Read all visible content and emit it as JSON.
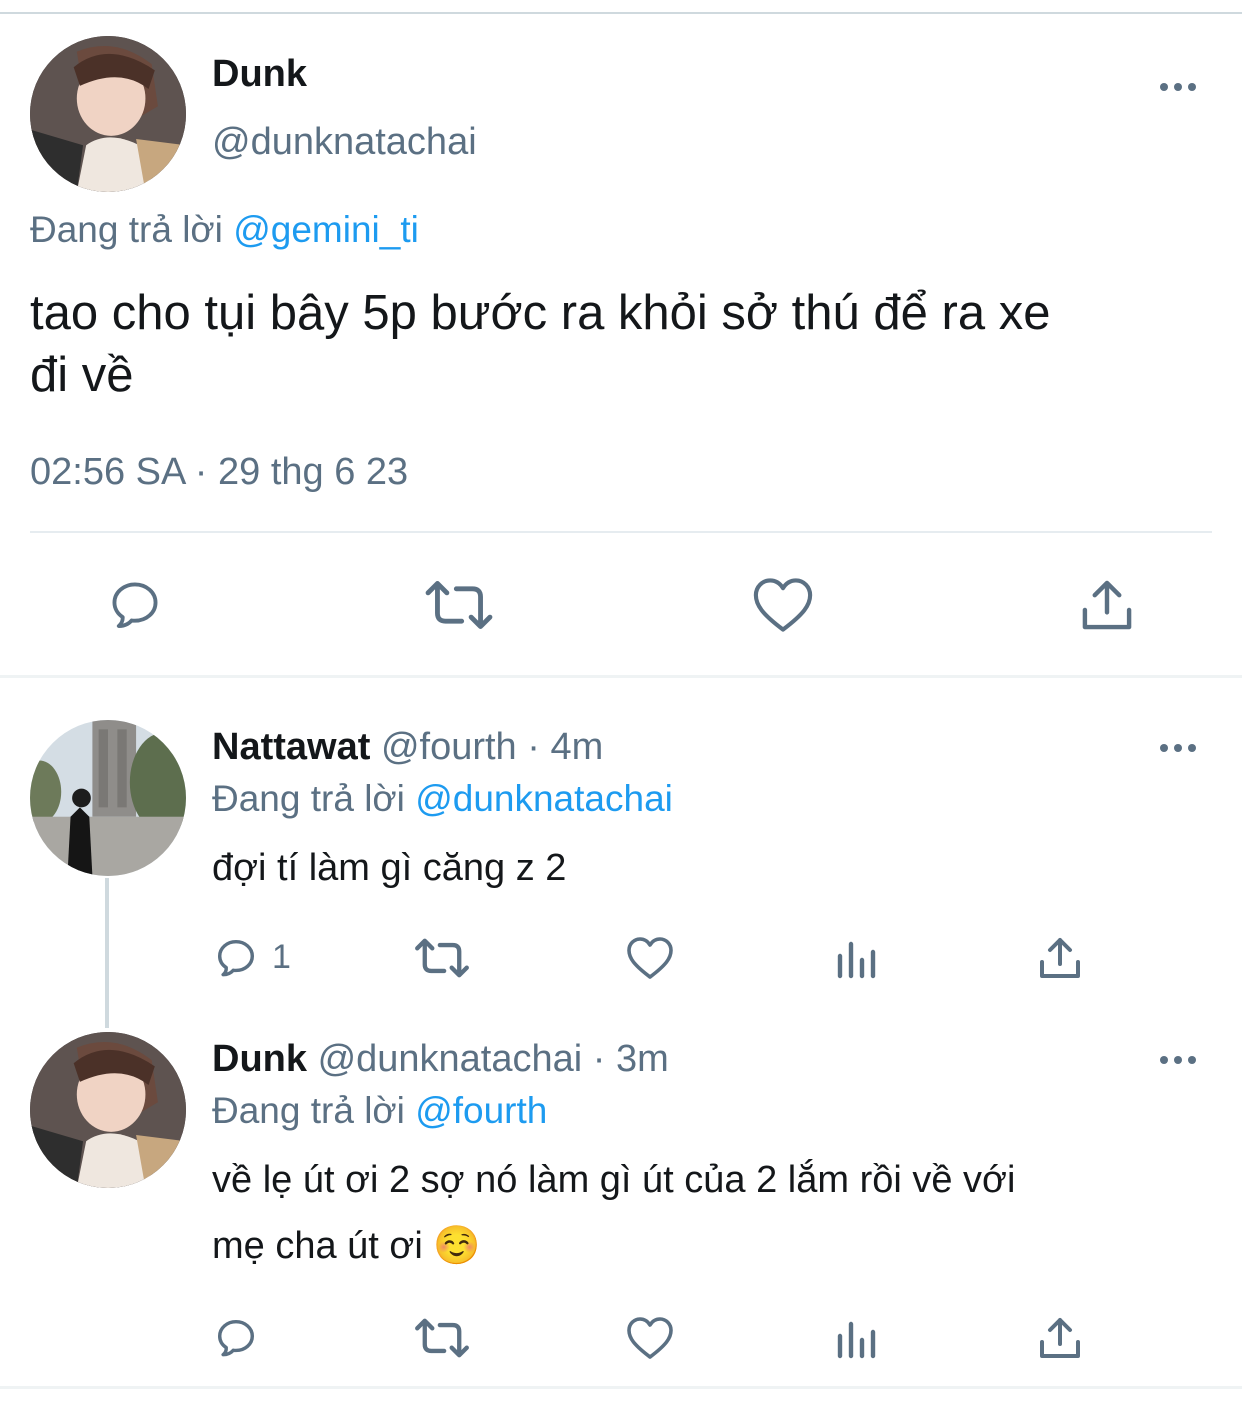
{
  "main_tweet": {
    "display_name": "Dunk",
    "handle": "@dunknatachai",
    "reply_prefix": "Đang trả lời",
    "reply_to": "@gemini_ti",
    "text_line1": "tao cho tụi bây 5p bước ra khỏi sở thú để ra xe",
    "text_line2": "đi về",
    "timestamp": "02:56 SA · 29 thg 6 23",
    "actions": [
      "reply-icon",
      "retweet-icon",
      "like-icon",
      "share-icon"
    ]
  },
  "replies": [
    {
      "display_name": "Nattawat",
      "meta": "@fourth · 4m",
      "reply_prefix": "Đang trả lời",
      "reply_to": "@dunknatachai",
      "text": "đợi tí làm gì căng z 2",
      "reply_count": "1"
    },
    {
      "display_name": "Dunk",
      "meta": "@dunknatachai · 3m",
      "reply_prefix": "Đang trả lời",
      "reply_to": "@fourth",
      "text_line1": "về lẹ út ơi 2 sợ nó làm gì út của 2 lắm rồi về với",
      "text_line2": "mẹ cha út ơi ☺️"
    }
  ],
  "colors": {
    "text": "#14171a",
    "muted": "#5b7083",
    "link": "#1d9bf0",
    "divider": "#e6ecf0"
  }
}
